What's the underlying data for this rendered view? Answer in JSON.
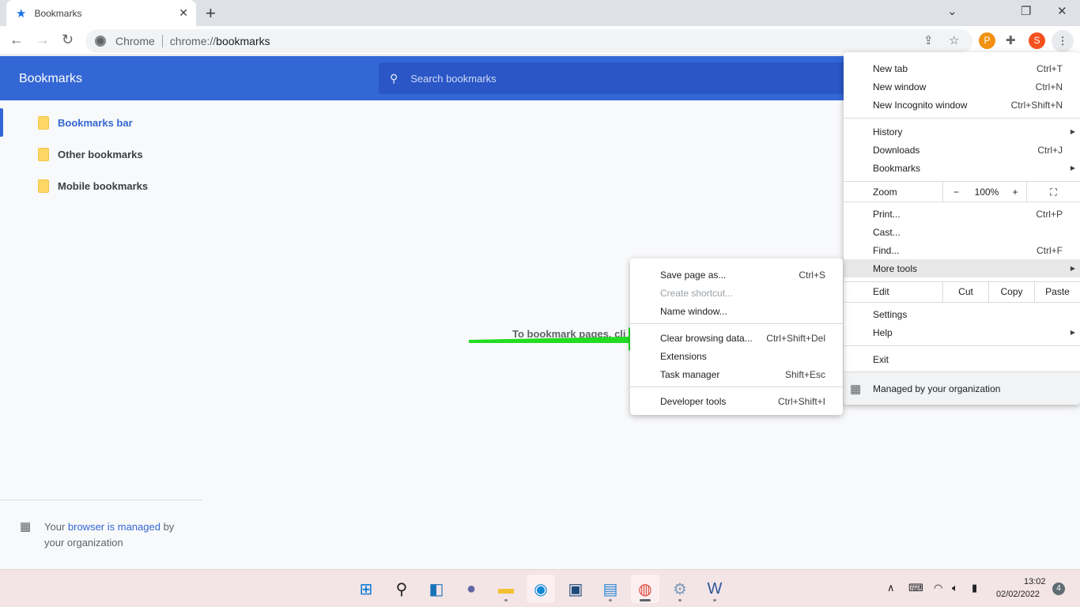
{
  "tab": {
    "title": "Bookmarks",
    "icon": "star-icon"
  },
  "toolbar": {
    "omnibox_label": "Chrome",
    "url_prefix": "chrome://",
    "url_host": "bookmarks",
    "profile_initial": "S"
  },
  "header": {
    "title": "Bookmarks",
    "search_placeholder": "Search bookmarks"
  },
  "sidebar": {
    "items": [
      {
        "label": "Bookmarks bar",
        "selected": true
      },
      {
        "label": "Other bookmarks"
      },
      {
        "label": "Mobile bookmarks"
      }
    ],
    "managed": {
      "pre": "Your ",
      "link": "browser is managed",
      "post": " by your organization"
    }
  },
  "main": {
    "empty_text": "To bookmark pages, cli"
  },
  "menu": {
    "new_tab": {
      "label": "New tab",
      "shortcut": "Ctrl+T"
    },
    "new_window": {
      "label": "New window",
      "shortcut": "Ctrl+N"
    },
    "incognito": {
      "label": "New Incognito window",
      "shortcut": "Ctrl+Shift+N"
    },
    "history": {
      "label": "History"
    },
    "downloads": {
      "label": "Downloads",
      "shortcut": "Ctrl+J"
    },
    "bookmarks": {
      "label": "Bookmarks"
    },
    "zoom": {
      "label": "Zoom",
      "minus": "−",
      "value": "100%",
      "plus": "+"
    },
    "print": {
      "label": "Print...",
      "shortcut": "Ctrl+P"
    },
    "cast": {
      "label": "Cast..."
    },
    "find": {
      "label": "Find...",
      "shortcut": "Ctrl+F"
    },
    "more_tools": {
      "label": "More tools"
    },
    "edit": {
      "label": "Edit",
      "cut": "Cut",
      "copy": "Copy",
      "paste": "Paste"
    },
    "settings": {
      "label": "Settings"
    },
    "help": {
      "label": "Help"
    },
    "exit": {
      "label": "Exit"
    },
    "managed": {
      "label": "Managed by your organization"
    }
  },
  "submenu": {
    "save": {
      "label": "Save page as...",
      "shortcut": "Ctrl+S"
    },
    "shortcut": {
      "label": "Create shortcut..."
    },
    "name_window": {
      "label": "Name window..."
    },
    "clear": {
      "label": "Clear browsing data...",
      "shortcut": "Ctrl+Shift+Del"
    },
    "extensions": {
      "label": "Extensions"
    },
    "task_manager": {
      "label": "Task manager",
      "shortcut": "Shift+Esc"
    },
    "devtools": {
      "label": "Developer tools",
      "shortcut": "Ctrl+Shift+I"
    }
  },
  "taskbar": {
    "time": "13:02",
    "date": "02/02/2022",
    "notifications": "4"
  },
  "colors": {
    "accent": "#3367d6",
    "arrow": "#22dd22"
  }
}
